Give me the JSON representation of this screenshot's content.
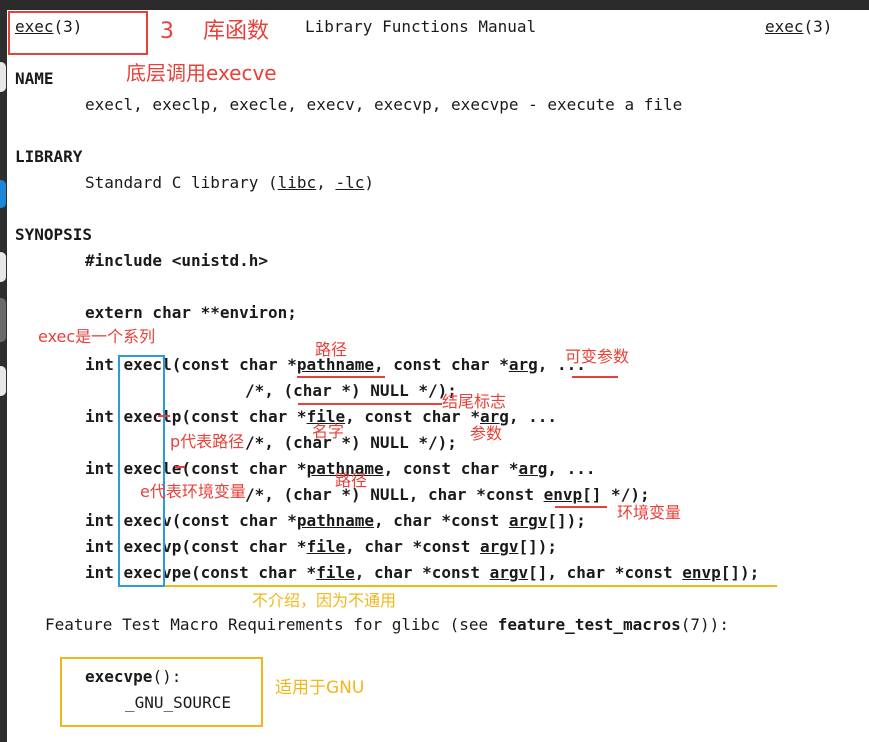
{
  "header": {
    "left_name": "exec",
    "left_sect": "(3)",
    "center": "Library Functions Manual",
    "right_name": "exec",
    "right_sect": "(3)"
  },
  "sections": {
    "name_heading": "NAME",
    "name_text": "execl, execlp, execle, execv, execvp, execvpe - execute a file",
    "library_heading": "LIBRARY",
    "library_pre": "Standard C library (",
    "library_libc": "libc",
    "library_sep": ", ",
    "library_lc": "-lc",
    "library_post": ")",
    "synopsis_heading": "SYNOPSIS",
    "include": "#include <unistd.h>",
    "extern": "extern char **environ;"
  },
  "synopsis": {
    "l1": {
      "a": "int execl(const char *",
      "p": "pathname",
      "b": ", const char *",
      "arg": "arg",
      "c": ", ",
      "dots": "...",
      "d": ""
    },
    "l1b": "/*, (char *) NULL */);",
    "l2": {
      "a": "int execlp(const char *",
      "p": "file",
      "b": ", const char *",
      "arg": "arg",
      "c": ", ..."
    },
    "l2b": "/*, (char *) NULL */);",
    "l3": {
      "a": "int execle(const char *",
      "p": "pathname",
      "b": ", const char *",
      "arg": "arg",
      "c": ", ..."
    },
    "l3b": {
      "a": "/*, (char *) NULL, char *const ",
      "envp": "envp",
      "c": "[] */);"
    },
    "l4": {
      "a": "int execv(const char *",
      "p": "pathname",
      "b": ", char *const ",
      "argv": "argv",
      "c": "[]);"
    },
    "l5": {
      "a": "int execvp(const char *",
      "p": "file",
      "b": ", char *const ",
      "argv": "argv",
      "c": "[]);"
    },
    "l6": {
      "a": "int execvpe(const char *",
      "p": "file",
      "b": ", char *const ",
      "argv": "argv",
      "c": "[], char *const ",
      "envp": "envp",
      "d": "[]);"
    }
  },
  "feature": {
    "pre": "Feature Test Macro Requirements for glibc (see ",
    "bold": "feature_test_macros",
    "post": "(7)):",
    "fn": "execvpe",
    "fn_paren": "():",
    "macro": "_GNU_SOURCE"
  },
  "annotations": {
    "num3": "3",
    "kuhanshu": "库函数",
    "diceng": "底层调用execve",
    "series": "exec是一个系列",
    "lujing1": "路径",
    "kebian": "可变参数",
    "jiewei": "结尾标志",
    "mingzi": "名字",
    "canshu": "参数",
    "p_daibiao": "p代表路径",
    "lujing2": "路径",
    "e_daibiao": "e代表环境变量",
    "huanjing": "环境变量",
    "bujieshao": "不介绍，因为不通用",
    "gnu": "适用于GNU"
  },
  "colors": {
    "red": "#e8403a",
    "blue": "#2b9bd9",
    "yellow": "#f2b619"
  }
}
